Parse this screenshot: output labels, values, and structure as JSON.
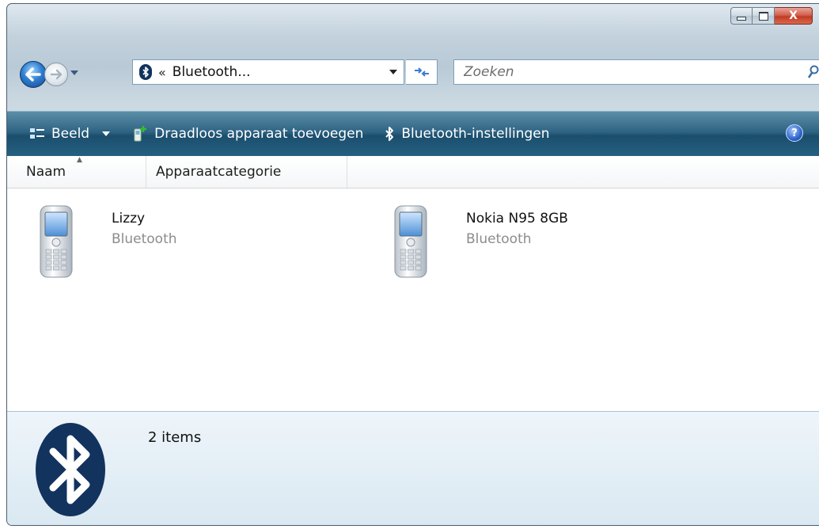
{
  "window": {
    "caption_close": "X"
  },
  "address_bar": {
    "chevrons": "«",
    "path_text": "Bluetooth...",
    "search_placeholder": "Zoeken"
  },
  "command_bar": {
    "items": [
      {
        "label": "Beeld"
      },
      {
        "label": "Draadloos apparaat toevoegen"
      },
      {
        "label": "Bluetooth-instellingen"
      }
    ],
    "help": "?"
  },
  "columns": {
    "name": "Naam",
    "category": "Apparaatcategorie"
  },
  "devices": [
    {
      "name": "Lizzy",
      "category": "Bluetooth",
      "icon": "mobile-phone-icon"
    },
    {
      "name": "Nokia N95 8GB",
      "category": "Bluetooth",
      "icon": "mobile-phone-icon"
    }
  ],
  "details": {
    "item_count": "2 items",
    "icon": "bluetooth-logo-icon"
  },
  "colors": {
    "command_bar": "#2f6484",
    "bluetooth_blue": "#12335e",
    "close_button": "#c23a25"
  }
}
